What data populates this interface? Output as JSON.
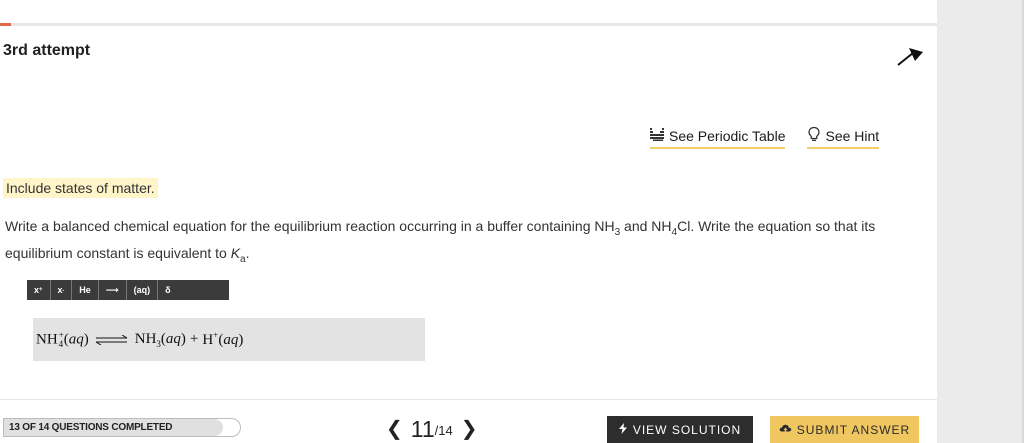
{
  "header": {
    "attempt_label": "3rd attempt",
    "progress_percent": 4.5
  },
  "links": {
    "periodic_table": "See Periodic Table",
    "hint": "See Hint"
  },
  "question": {
    "instruction": "Include states of matter.",
    "text_1": "Write a balanced chemical equation for the equilibrium reaction occurring in a buffer containing NH",
    "sub_1": "3",
    "text_2": " and NH",
    "sub_2": "4",
    "text_3": "Cl. Write the equation so that its equilibrium constant is equivalent to ",
    "k": "K",
    "k_sub": "a",
    "text_4": "."
  },
  "toolbar": {
    "superscript": "x",
    "superscript_mark": "+",
    "subscript": "x",
    "subscript_mark": ".",
    "element": "He",
    "arrow": "⟶",
    "state": "(aq)",
    "delta": "δ"
  },
  "answer": {
    "r_species": "NH",
    "r_sub": "4",
    "r_sup": "+",
    "r_state": "aq",
    "p1_species": "NH",
    "p1_sub": "3",
    "p1_state": "aq",
    "plus": "+",
    "p2_species": "H",
    "p2_sup": "+",
    "p2_state": "aq"
  },
  "footer": {
    "progress_text": "13 OF 14 QUESTIONS COMPLETED",
    "progress_fraction": 0.93,
    "current": "11",
    "total": "/14",
    "view_solution": "VIEW SOLUTION",
    "submit": "SUBMIT ANSWER"
  },
  "colors": {
    "accent": "#e06a4a",
    "highlight": "#fff5c9",
    "submit": "#f0c660",
    "dark": "#2d2d2d"
  }
}
